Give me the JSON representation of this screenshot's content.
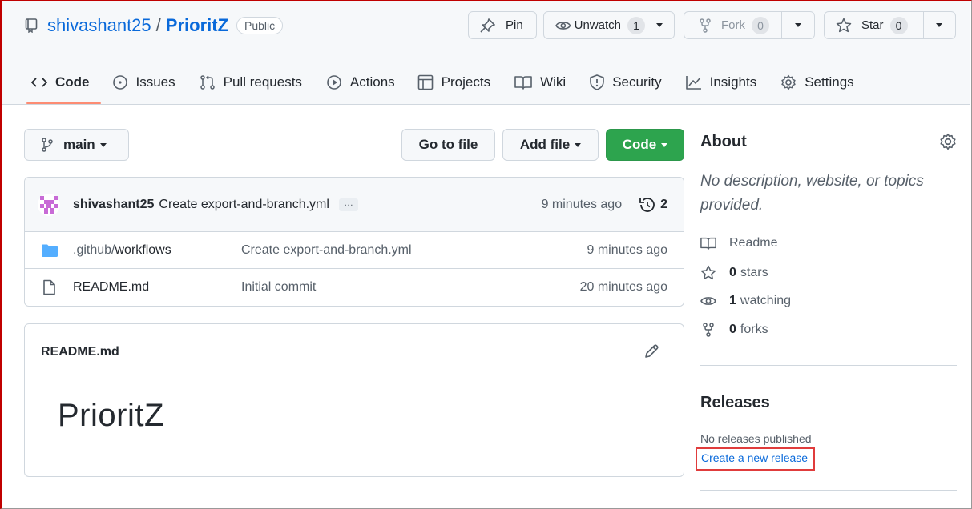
{
  "repo": {
    "owner": "shivashant25",
    "separator": "/",
    "name": "PrioritZ",
    "visibility": "Public"
  },
  "actions": {
    "pin_label": "Pin",
    "unwatch_label": "Unwatch",
    "watch_count": "1",
    "fork_label": "Fork",
    "fork_count": "0",
    "star_label": "Star",
    "star_count": "0"
  },
  "tabs": [
    {
      "label": "Code",
      "icon": "code-icon",
      "selected": true
    },
    {
      "label": "Issues",
      "icon": "issue-icon"
    },
    {
      "label": "Pull requests",
      "icon": "pull-request-icon"
    },
    {
      "label": "Actions",
      "icon": "play-icon"
    },
    {
      "label": "Projects",
      "icon": "table-icon"
    },
    {
      "label": "Wiki",
      "icon": "book-icon"
    },
    {
      "label": "Security",
      "icon": "shield-icon"
    },
    {
      "label": "Insights",
      "icon": "graph-icon"
    },
    {
      "label": "Settings",
      "icon": "gear-icon"
    }
  ],
  "toolbar": {
    "branch": "main",
    "go_to_file": "Go to file",
    "add_file": "Add file",
    "code": "Code"
  },
  "commit": {
    "author": "shivashant25",
    "message": "Create export-and-branch.yml",
    "ellipsis": "…",
    "time": "9 minutes ago",
    "history_count": "2"
  },
  "files": [
    {
      "name_dim": ".github/",
      "name": "workflows",
      "message": "Create export-and-branch.yml",
      "time": "9 minutes ago",
      "type": "folder"
    },
    {
      "name_dim": "",
      "name": "README.md",
      "message": "Initial commit",
      "time": "20 minutes ago",
      "type": "file"
    }
  ],
  "readme": {
    "title": "README.md",
    "heading": "PrioritZ"
  },
  "about": {
    "title": "About",
    "description": "No description, website, or topics provided.",
    "readme_label": "Readme",
    "stars_count": "0",
    "stars_label": "stars",
    "watching_count": "1",
    "watching_label": "watching",
    "forks_count": "0",
    "forks_label": "forks"
  },
  "releases": {
    "title": "Releases",
    "none_text": "No releases published",
    "create_link": "Create a new release"
  },
  "colors": {
    "accent": "#0969da",
    "green": "#2da44e",
    "tab_underline": "#fd8c73",
    "highlight_box": "#e03c3c"
  }
}
